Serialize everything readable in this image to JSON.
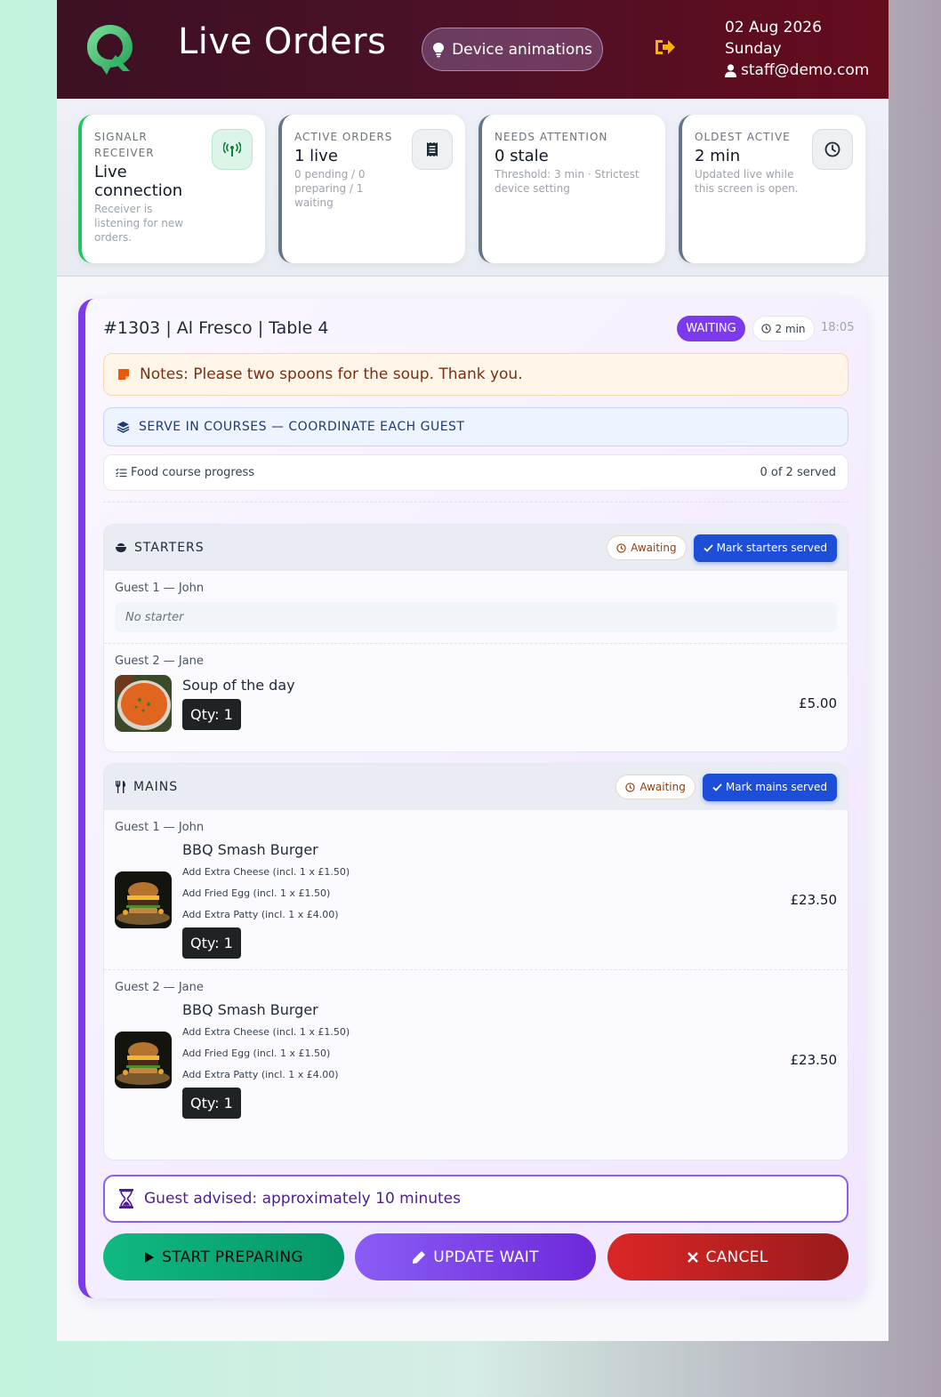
{
  "header": {
    "title": "Live Orders",
    "animations_button": "Device animations",
    "date": "02 Aug 2026",
    "weekday": "Sunday",
    "user_email": "staff@demo.com"
  },
  "stats": [
    {
      "label": "SIGNALR RECEIVER",
      "value": "Live connection",
      "sub": "Receiver is listening for new orders.",
      "icon": "antenna-icon",
      "accent": "#22c55e"
    },
    {
      "label": "ACTIVE ORDERS",
      "value": "1 live",
      "sub": "0 pending / 0 preparing / 1 waiting",
      "icon": "receipt-icon",
      "accent": "#64748b"
    },
    {
      "label": "NEEDS ATTENTION",
      "value": "0 stale",
      "sub": "Threshold: 3 min · Strictest device setting",
      "icon": "",
      "accent": "#64748b"
    },
    {
      "label": "OLDEST ACTIVE",
      "value": "2 min",
      "sub": "Updated live while this screen is open.",
      "icon": "clock-icon",
      "accent": "#64748b"
    }
  ],
  "order": {
    "title": "#1303 | Al Fresco | Table 4",
    "status": "WAITING",
    "age": "2 min",
    "time": "18:05",
    "notes": "Notes: Please two spoons for the soup. Thank you.",
    "courses_banner": "SERVE IN COURSES — COORDINATE EACH GUEST",
    "progress_label": "Food course progress",
    "progress_value": "0 of 2 served",
    "starters": {
      "name": "STARTERS",
      "status": "Awaiting",
      "button": "Mark starters served",
      "guest1": {
        "name": "Guest 1 — John",
        "empty": "No starter"
      },
      "guest2": {
        "name": "Guest 2 — Jane",
        "item": "Soup of the day",
        "qty": "Qty: 1",
        "price": "£5.00"
      }
    },
    "mains": {
      "name": "MAINS",
      "status": "Awaiting",
      "button": "Mark mains served",
      "guest1": {
        "name": "Guest 1 — John",
        "item": "BBQ Smash Burger",
        "mods": [
          "Add Extra Cheese (incl. 1 x £1.50)",
          "Add Fried Egg (incl. 1 x £1.50)",
          "Add Extra Patty (incl. 1 x £4.00)"
        ],
        "qty": "Qty: 1",
        "price": "£23.50"
      },
      "guest2": {
        "name": "Guest 2 — Jane",
        "item": "BBQ Smash Burger",
        "mods": [
          "Add Extra Cheese (incl. 1 x £1.50)",
          "Add Fried Egg (incl. 1 x £1.50)",
          "Add Extra Patty (incl. 1 x £4.00)"
        ],
        "qty": "Qty: 1",
        "price": "£23.50"
      }
    },
    "advised": "Guest advised: approximately 10 minutes",
    "actions": {
      "start": "START PREPARING",
      "update": "UPDATE WAIT",
      "cancel": "CANCEL"
    }
  },
  "colors": {
    "accent": "#7c3aed",
    "primary": "#1d4ed8",
    "success": "#10b981",
    "danger": "#dc2626"
  }
}
